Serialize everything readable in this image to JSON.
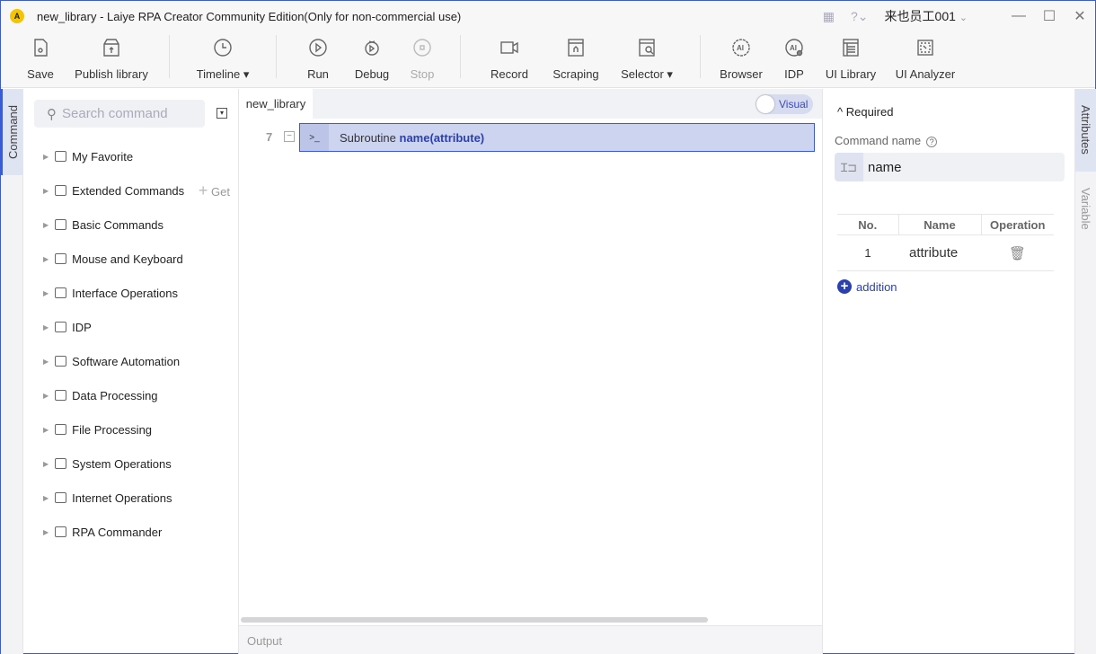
{
  "window": {
    "title": "new_library - Laiye RPA Creator Community Edition(Only for non-commercial use)",
    "user": "来也员工001"
  },
  "toolbar": [
    {
      "id": "save",
      "label": "Save",
      "icon": "save-icon"
    },
    {
      "id": "publish",
      "label": "Publish library",
      "icon": "publish-icon"
    },
    {
      "id": "timeline",
      "label": "Timeline",
      "icon": "clock-icon",
      "dropdown": true
    },
    {
      "id": "run",
      "label": "Run",
      "icon": "play-icon"
    },
    {
      "id": "debug",
      "label": "Debug",
      "icon": "bug-icon"
    },
    {
      "id": "stop",
      "label": "Stop",
      "icon": "stop-icon",
      "disabled": true
    },
    {
      "id": "record",
      "label": "Record",
      "icon": "camera-icon"
    },
    {
      "id": "scraping",
      "label": "Scraping",
      "icon": "scraping-icon"
    },
    {
      "id": "selector",
      "label": "Selector",
      "icon": "selector-icon",
      "dropdown": true
    },
    {
      "id": "browser",
      "label": "Browser",
      "icon": "ai-browser-icon"
    },
    {
      "id": "idp",
      "label": "IDP",
      "icon": "ai-idp-icon"
    },
    {
      "id": "uilibrary",
      "label": "UI Library",
      "icon": "ui-library-icon"
    },
    {
      "id": "uianalyzer",
      "label": "UI Analyzer",
      "icon": "ui-analyzer-icon"
    }
  ],
  "left_rail": {
    "tab": "Command"
  },
  "sidebar": {
    "search_placeholder": "Search command",
    "items": [
      {
        "label": "My Favorite"
      },
      {
        "label": "Extended Commands",
        "extra": "Get"
      },
      {
        "label": "Basic Commands"
      },
      {
        "label": "Mouse and Keyboard"
      },
      {
        "label": "Interface Operations"
      },
      {
        "label": "IDP"
      },
      {
        "label": "Software Automation"
      },
      {
        "label": "Data Processing"
      },
      {
        "label": "File Processing"
      },
      {
        "label": "System Operations"
      },
      {
        "label": "Internet Operations"
      },
      {
        "label": "RPA Commander"
      }
    ]
  },
  "editor": {
    "tab": "new_library",
    "toggle": "Visual",
    "line_number": "7",
    "keyword": "Subroutine",
    "signature": "name(attribute)",
    "output": "Output"
  },
  "attributes": {
    "section": "Required",
    "command_name_label": "Command name",
    "command_name": "name",
    "table": {
      "headers": [
        "No.",
        "Name",
        "Operation"
      ],
      "rows": [
        {
          "no": "1",
          "name": "attribute"
        }
      ]
    },
    "add_label": "addition"
  },
  "right_rail": {
    "tabs": [
      "Attributes",
      "Variable"
    ]
  },
  "colors": {
    "accent": "#3b5bd6",
    "selection": "#cdd4ef"
  }
}
